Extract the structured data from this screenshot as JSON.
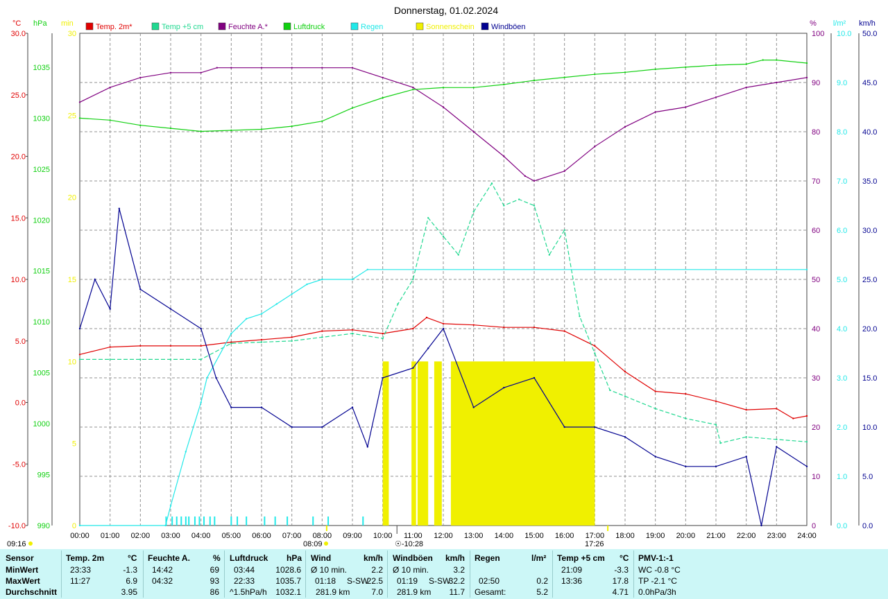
{
  "title": "Donnerstag, 01.02.2024",
  "colors": {
    "temp": "#e00000",
    "temp5": "#20d890",
    "humidity": "#800080",
    "pressure": "#10d010",
    "rain": "#20e8e8",
    "sun": "#f0f000",
    "gust": "#000090",
    "grid": "#909090",
    "panel": "#ccf7f7"
  },
  "axes": {
    "temp_unit": "°C",
    "pressure_unit": "hPa",
    "sun_unit": "min",
    "hum_unit": "%",
    "rain_unit": "l/m²",
    "wind_unit": "km/h",
    "temp_ticks": [
      "30.0",
      "25.0",
      "20.0",
      "15.0",
      "10.0",
      "5.0",
      "0.0",
      "-5.0",
      "-10.0"
    ],
    "pressure_ticks": [
      "1035",
      "1030",
      "1025",
      "1020",
      "1015",
      "1010",
      "1005",
      "1000",
      "995",
      "990"
    ],
    "sun_ticks": [
      "30",
      "25",
      "20",
      "15",
      "10",
      "5",
      "0"
    ],
    "hum_ticks": [
      "100",
      "90",
      "80",
      "70",
      "60",
      "50",
      "40",
      "30",
      "20",
      "10",
      "0"
    ],
    "rain_ticks": [
      "10.0",
      "9.0",
      "8.0",
      "7.0",
      "6.0",
      "5.0",
      "4.0",
      "3.0",
      "2.0",
      "1.0",
      "0.0"
    ],
    "wind_ticks": [
      "50.0",
      "45.0",
      "40.0",
      "35.0",
      "30.0",
      "25.0",
      "20.0",
      "15.0",
      "10.0",
      "5.0",
      "0.0"
    ],
    "x_ticks": [
      "00:00",
      "01:00",
      "02:00",
      "03:00",
      "04:00",
      "05:00",
      "06:00",
      "07:00",
      "08:00",
      "09:00",
      "10:00",
      "11:00",
      "12:00",
      "13:00",
      "14:00",
      "15:00",
      "16:00",
      "17:00",
      "18:00",
      "19:00",
      "20:00",
      "21:00",
      "22:00",
      "23:00",
      "24:00"
    ]
  },
  "markers": {
    "moonrise": "09:16",
    "sunrise": "08:09",
    "transit": "10:28",
    "sunset": "17:26"
  },
  "chart_data": {
    "type": "line",
    "title": "Donnerstag, 01.02.2024",
    "x_range": [
      "00:00",
      "24:00"
    ],
    "series": [
      {
        "name": "Temp. 2m*",
        "axis": "°C",
        "ylim": [
          -10,
          30
        ],
        "points": [
          [
            0,
            3.9
          ],
          [
            1,
            4.5
          ],
          [
            2,
            4.6
          ],
          [
            3,
            4.6
          ],
          [
            4,
            4.6
          ],
          [
            5,
            4.9
          ],
          [
            6,
            5.1
          ],
          [
            7,
            5.3
          ],
          [
            8,
            5.8
          ],
          [
            9,
            5.9
          ],
          [
            10,
            5.6
          ],
          [
            11,
            6.0
          ],
          [
            11.45,
            6.9
          ],
          [
            12,
            6.4
          ],
          [
            13,
            6.3
          ],
          [
            14,
            6.1
          ],
          [
            15,
            6.1
          ],
          [
            16,
            5.8
          ],
          [
            17,
            4.6
          ],
          [
            18,
            2.5
          ],
          [
            19,
            0.9
          ],
          [
            20,
            0.7
          ],
          [
            21,
            0.1
          ],
          [
            22,
            -0.6
          ],
          [
            23,
            -0.5
          ],
          [
            23.55,
            -1.3
          ],
          [
            24,
            -1.1
          ]
        ]
      },
      {
        "name": "Temp +5 cm",
        "axis": "°C",
        "ylim": [
          -10,
          30
        ],
        "points": [
          [
            0,
            3.5
          ],
          [
            1,
            3.5
          ],
          [
            2,
            3.5
          ],
          [
            3,
            3.5
          ],
          [
            4,
            3.5
          ],
          [
            5,
            4.8
          ],
          [
            6,
            4.9
          ],
          [
            7,
            5.0
          ],
          [
            8,
            5.3
          ],
          [
            9,
            5.6
          ],
          [
            10,
            5.2
          ],
          [
            10.5,
            8.0
          ],
          [
            11,
            10.0
          ],
          [
            11.5,
            15.0
          ],
          [
            12,
            13.5
          ],
          [
            12.5,
            12.0
          ],
          [
            13,
            15.5
          ],
          [
            13.6,
            17.8
          ],
          [
            14,
            16.0
          ],
          [
            14.5,
            16.5
          ],
          [
            15,
            16.0
          ],
          [
            15.5,
            12.0
          ],
          [
            16,
            14.0
          ],
          [
            16.5,
            7.0
          ],
          [
            17,
            4.0
          ],
          [
            17.5,
            1.0
          ],
          [
            18,
            0.5
          ],
          [
            19,
            -0.5
          ],
          [
            20,
            -1.3
          ],
          [
            21,
            -1.8
          ],
          [
            21.15,
            -3.3
          ],
          [
            22,
            -2.8
          ],
          [
            23,
            -3.0
          ],
          [
            24,
            -3.2
          ]
        ]
      },
      {
        "name": "Feuchte A.*",
        "axis": "%",
        "ylim": [
          0,
          100
        ],
        "points": [
          [
            0,
            86
          ],
          [
            1,
            89
          ],
          [
            2,
            91
          ],
          [
            3,
            92
          ],
          [
            4,
            92
          ],
          [
            4.53,
            93
          ],
          [
            5,
            93
          ],
          [
            6,
            93
          ],
          [
            7,
            93
          ],
          [
            8,
            93
          ],
          [
            9,
            93
          ],
          [
            10,
            91
          ],
          [
            11,
            89
          ],
          [
            12,
            85
          ],
          [
            13,
            80
          ],
          [
            14,
            75
          ],
          [
            14.7,
            71
          ],
          [
            15,
            70
          ],
          [
            16,
            72
          ],
          [
            17,
            77
          ],
          [
            18,
            81
          ],
          [
            19,
            84
          ],
          [
            20,
            85
          ],
          [
            21,
            87
          ],
          [
            22,
            89
          ],
          [
            23,
            90
          ],
          [
            24,
            91
          ]
        ]
      },
      {
        "name": "Luftdruck",
        "axis": "hPa",
        "ylim": [
          990,
          1038
        ],
        "points": [
          [
            0,
            1030
          ],
          [
            1,
            1029.8
          ],
          [
            2,
            1029.3
          ],
          [
            3,
            1029
          ],
          [
            4,
            1028.7
          ],
          [
            5,
            1028.8
          ],
          [
            6,
            1028.9
          ],
          [
            7,
            1029.2
          ],
          [
            8,
            1029.7
          ],
          [
            9,
            1031
          ],
          [
            10,
            1032
          ],
          [
            11,
            1032.8
          ],
          [
            12,
            1033
          ],
          [
            13,
            1033
          ],
          [
            14,
            1033.3
          ],
          [
            15,
            1033.7
          ],
          [
            16,
            1034
          ],
          [
            17,
            1034.3
          ],
          [
            18,
            1034.5
          ],
          [
            19,
            1034.8
          ],
          [
            20,
            1035
          ],
          [
            21,
            1035.2
          ],
          [
            22,
            1035.3
          ],
          [
            22.55,
            1035.7
          ],
          [
            23,
            1035.7
          ],
          [
            24,
            1035.4
          ]
        ]
      },
      {
        "name": "Regen",
        "axis": "l/m²",
        "ylim": [
          0,
          10
        ],
        "points": [
          [
            0,
            0
          ],
          [
            2.83,
            0
          ],
          [
            3,
            0.4
          ],
          [
            3.5,
            1.5
          ],
          [
            4,
            2.5
          ],
          [
            4.2,
            3.0
          ],
          [
            5,
            3.9
          ],
          [
            5.5,
            4.2
          ],
          [
            6,
            4.3
          ],
          [
            6.5,
            4.5
          ],
          [
            7,
            4.7
          ],
          [
            7.5,
            4.9
          ],
          [
            8,
            5.0
          ],
          [
            9,
            5.0
          ],
          [
            9.5,
            5.2
          ],
          [
            24,
            5.2
          ]
        ]
      },
      {
        "name": "Sonnenschein",
        "axis": "min",
        "ylim": [
          0,
          30
        ],
        "points": [
          [
            10,
            10
          ],
          [
            10.2,
            10
          ],
          [
            11,
            10
          ],
          [
            11.5,
            10
          ],
          [
            12,
            10
          ],
          [
            12.3,
            10
          ],
          [
            13,
            10
          ],
          [
            14,
            10
          ],
          [
            15,
            10
          ],
          [
            16,
            10
          ],
          [
            16.5,
            10
          ],
          [
            17,
            10
          ]
        ]
      },
      {
        "name": "Windböen",
        "axis": "km/h",
        "ylim": [
          0,
          50
        ],
        "points": [
          [
            0,
            20
          ],
          [
            0.5,
            25
          ],
          [
            1,
            22
          ],
          [
            1.3,
            32.2
          ],
          [
            2,
            24
          ],
          [
            3,
            22
          ],
          [
            4,
            20
          ],
          [
            4.5,
            15
          ],
          [
            5,
            12
          ],
          [
            6,
            12
          ],
          [
            7,
            10
          ],
          [
            8,
            10
          ],
          [
            9,
            12
          ],
          [
            9.5,
            8
          ],
          [
            10,
            15
          ],
          [
            11,
            16
          ],
          [
            11.5,
            18
          ],
          [
            12,
            20
          ],
          [
            13,
            12
          ],
          [
            14,
            14
          ],
          [
            15,
            15
          ],
          [
            16,
            10
          ],
          [
            17,
            10
          ],
          [
            18,
            9
          ],
          [
            19,
            7
          ],
          [
            20,
            6
          ],
          [
            21,
            6
          ],
          [
            22,
            7
          ],
          [
            22.5,
            0
          ],
          [
            23,
            8
          ],
          [
            24,
            6
          ]
        ]
      }
    ],
    "sunshine_bars": [
      [
        10.0,
        10.2
      ],
      [
        10.95,
        11.1
      ],
      [
        11.15,
        11.5
      ],
      [
        11.7,
        11.95
      ],
      [
        12.25,
        17.0
      ]
    ],
    "rain_ticks_at": [
      2.85,
      3.05,
      3.2,
      3.35,
      3.5,
      3.6,
      3.8,
      3.95,
      4.1,
      4.3,
      4.45,
      5.0,
      5.2,
      5.5,
      6.1,
      6.45,
      6.85,
      7.7,
      8.2,
      9.35
    ],
    "ylabel_left": "°C",
    "ylabel_right": "%"
  },
  "legend": [
    {
      "label": "Temp. 2m*",
      "color": "#e00000"
    },
    {
      "label": "Temp +5 cm",
      "color": "#20d890"
    },
    {
      "label": "Feuchte A.*",
      "color": "#800080"
    },
    {
      "label": "Luftdruck",
      "color": "#10d010"
    },
    {
      "label": "Regen",
      "color": "#20e8e8"
    },
    {
      "label": "Sonnenschein",
      "color": "#f0f000"
    },
    {
      "label": "Windböen",
      "color": "#000090"
    }
  ],
  "stats": {
    "row_labels": [
      "Sensor",
      "MinWert",
      "MaxWert",
      "Durchschnitt"
    ],
    "temp": {
      "head": "Temp. 2m",
      "unit": "°C",
      "min_time": "23:33",
      "min": "-1.3",
      "max_time": "11:27",
      "max": "6.9",
      "avg": "3.95"
    },
    "hum": {
      "head": "Feuchte A.",
      "unit": "%",
      "min_time": "14:42",
      "min": "69",
      "max_time": "04:32",
      "max": "93",
      "avg": "86"
    },
    "press": {
      "head": "Luftdruck",
      "unit": "hPa",
      "min_time": "03:44",
      "min": "1028.6",
      "max_time": "22:33",
      "max": "1035.7",
      "avg_note": "^1.5hPa/h",
      "avg": "1032.1"
    },
    "wind": {
      "head": "Wind",
      "unit": "km/h",
      "r1a": "Ø 10 min.",
      "r1b": "2.2",
      "r2a": "01:18",
      "r2b": "S-SW",
      "r2c": "22.5",
      "r3a": "281.9 km",
      "r3b": "7.0"
    },
    "gust": {
      "head": "Windböen",
      "unit": "km/h",
      "r1a": "Ø 10 min.",
      "r1b": "3.2",
      "r2a": "01:19",
      "r2b": "S-SW",
      "r2c": "32.2",
      "r3a": "281.9 km",
      "r3b": "11.7"
    },
    "rain": {
      "head": "Regen",
      "unit": "l/m²",
      "r2a": "02:50",
      "r2b": "0.2",
      "r3a": "Gesamt:",
      "r3b": "5.2"
    },
    "t5": {
      "head": "Temp +5 cm",
      "unit": "°C",
      "min_time": "21:09",
      "min": "-3.3",
      "max_time": "13:36",
      "max": "17.8",
      "avg": "4.71"
    },
    "pmv": {
      "head": "PMV-1:-1",
      "r1": "WC -0.8 °C",
      "r2": "TP -2.1 °C",
      "r3": "0.0hPa/3h"
    }
  }
}
